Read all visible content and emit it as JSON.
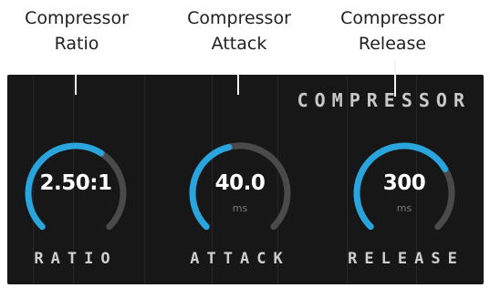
{
  "callouts": [
    {
      "line1": "Compressor",
      "line2": "Ratio"
    },
    {
      "line1": "Compressor",
      "line2": "Attack"
    },
    {
      "line1": "Compressor",
      "line2": "Release"
    }
  ],
  "panel": {
    "title": "COMPRESSOR"
  },
  "knobs": [
    {
      "name": "ratio",
      "value": "2.50:1",
      "unit": "",
      "label": "RATIO",
      "level": 0.62
    },
    {
      "name": "attack",
      "value": "40.0",
      "unit": "ms",
      "label": "ATTACK",
      "level": 0.45
    },
    {
      "name": "release",
      "value": "300",
      "unit": "ms",
      "label": "RELEASE",
      "level": 0.72
    }
  ],
  "colors": {
    "panel_bg": "#171717",
    "arc_active": "#2aa4dc",
    "arc_track": "#4a4a4a",
    "text_primary": "#ffffff",
    "text_label": "#cfcfcf",
    "callout_line": "#f2f2f2"
  }
}
